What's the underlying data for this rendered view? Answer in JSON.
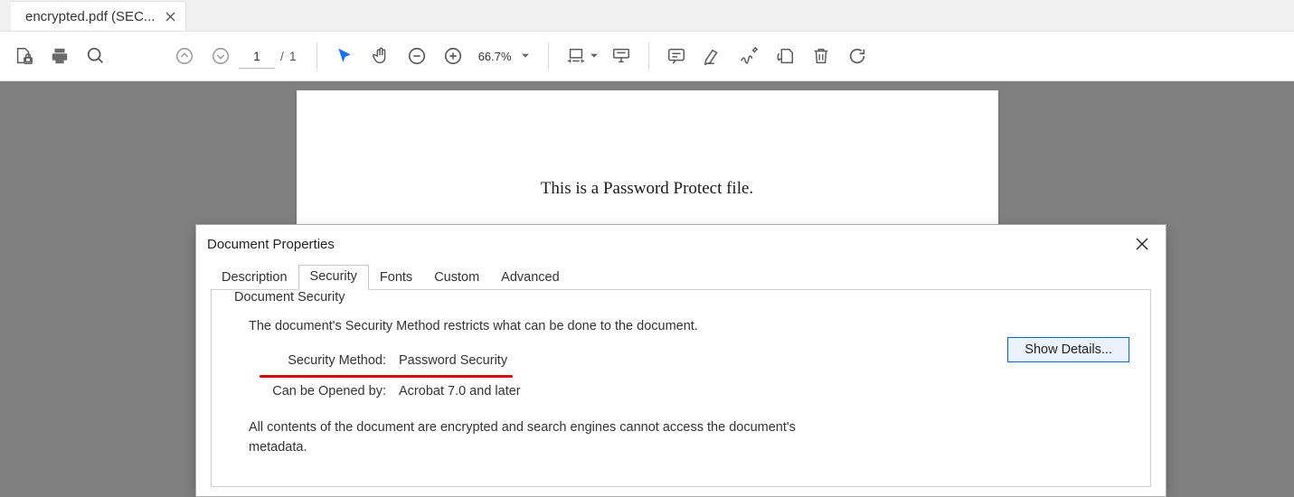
{
  "tab": {
    "title": "encrypted.pdf (SEC..."
  },
  "toolbar": {
    "page_current": "1",
    "page_total": "1",
    "zoom": "66.7%"
  },
  "document": {
    "line1": "This is a Password Protect file."
  },
  "dialog": {
    "title": "Document Properties",
    "tabs": {
      "description": "Description",
      "security": "Security",
      "fonts": "Fonts",
      "custom": "Custom",
      "advanced": "Advanced"
    },
    "section_title": "Document Security",
    "intro": "The document's Security Method restricts what can be done to the document.",
    "security_method_label": "Security Method:",
    "security_method_value": "Password Security",
    "opened_by_label": "Can be Opened by:",
    "opened_by_value": "Acrobat 7.0 and later",
    "note": "All contents of the document are encrypted and search engines cannot access the document's metadata.",
    "show_details_label": "Show Details..."
  }
}
